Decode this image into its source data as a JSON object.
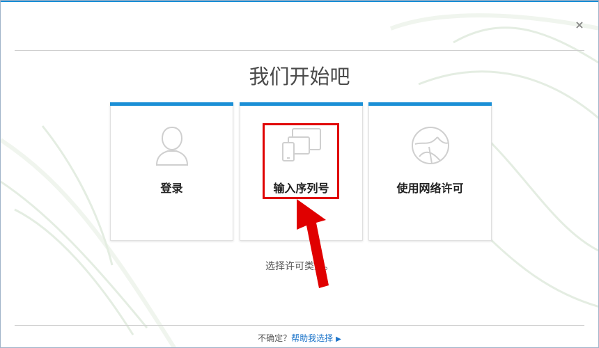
{
  "dialog": {
    "title": "我们开始吧",
    "close_symbol": "×",
    "options": [
      {
        "label": "登录",
        "icon": "user-icon"
      },
      {
        "label": "输入序列号",
        "icon": "devices-icon"
      },
      {
        "label": "使用网络许可",
        "icon": "network-globe-icon"
      }
    ],
    "hint": "选择许可类型。",
    "footer": {
      "prefix": "不确定？",
      "help_link": "帮助我选择",
      "arrow_icon": "triangle-right-icon"
    }
  },
  "colors": {
    "accent": "#1b8fd6",
    "highlight": "#e00000",
    "link": "#1a73c9"
  }
}
